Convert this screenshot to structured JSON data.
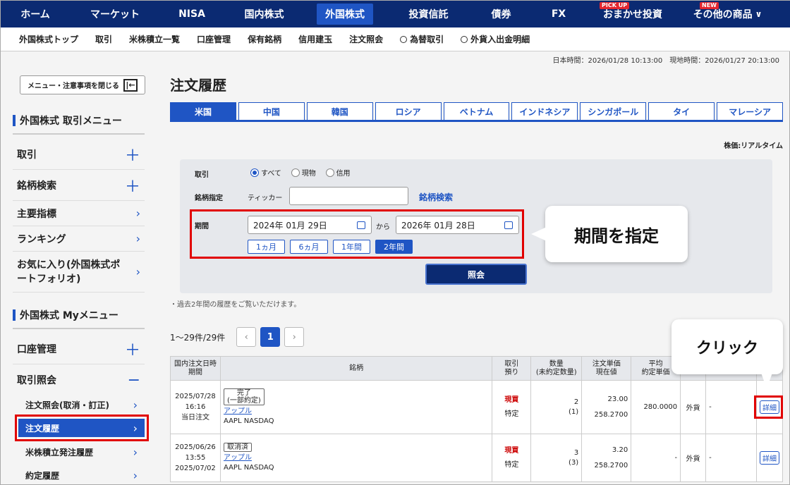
{
  "topnav": {
    "items": [
      "ホーム",
      "マーケット",
      "NISA",
      "国内株式",
      "外国株式",
      "投資信託",
      "債券",
      "FX",
      "おまかせ投資",
      "その他の商品"
    ],
    "badge_pickup": "PICK UP",
    "badge_new": "NEW",
    "chevron": "∨"
  },
  "subnav": {
    "items": [
      "外国株式トップ",
      "取引",
      "米株積立一覧",
      "口座管理",
      "保有銘柄",
      "信用建玉",
      "注文照会",
      "為替取引",
      "外貨入出金明細"
    ]
  },
  "times": {
    "text": "日本時間：2026/01/28 10:13:00　現地時間：2026/01/27 20:13:00"
  },
  "sidebar": {
    "close_label": "メニュー・注意事項を閉じる",
    "section1": "外国株式 取引メニュー",
    "items1": [
      "取引",
      "銘柄検索",
      "主要指標",
      "ランキング",
      "お気に入り(外国株式ポートフォリオ)"
    ],
    "section2": "外国株式 Myメニュー",
    "items2": [
      "口座管理",
      "取引照会"
    ],
    "sub_items": [
      "注文照会(取消・訂正)",
      "注文履歴",
      "米株積立発注履歴",
      "約定履歴"
    ],
    "plus": "＋",
    "minus": "−",
    "chev": "›"
  },
  "main": {
    "title": "注文履歴",
    "tabs": [
      "米国",
      "中国",
      "韓国",
      "ロシア",
      "ベトナム",
      "インドネシア",
      "シンガポール",
      "タイ",
      "マレーシア"
    ],
    "realtime": "株価:リアルタイム"
  },
  "form": {
    "trade_label": "取引",
    "radios": [
      "すべて",
      "現物",
      "信用"
    ],
    "symbol_label": "銘柄指定",
    "ticker_label": "ティッカー",
    "ticker_value": "",
    "search_link": "銘柄検索",
    "period_label": "期間",
    "date_from": "2024年 01月 29日",
    "from_label": "から",
    "date_to": "2026年 01月 28日",
    "period_buttons": [
      "1ヵ月",
      "6ヵ月",
      "1年間",
      "2年間"
    ],
    "submit": "照会"
  },
  "callouts": {
    "period": "期間を指定",
    "click": "クリック"
  },
  "note": "・過去2年間の履歴をご覧いただけます。",
  "pager": {
    "count": "1～29件/29件",
    "prev": "‹",
    "page": "1",
    "next": "›"
  },
  "table": {
    "headers": [
      "国内注文日時\n期間",
      "銘柄",
      "取引\n預り",
      "数量\n(未約定数量)",
      "注文単価\n現在値",
      "平均\n約定単価",
      "",
      ""
    ],
    "rows": [
      {
        "date": "2025/07/28",
        "time": "16:16",
        "period": "当日注文",
        "status": "完了\n(一部約定)",
        "name": "アップル",
        "ticker": "AAPL NASDAQ",
        "trade": "現買",
        "acct": "特定",
        "qty": "2",
        "qty2": "(1)",
        "price": "23.00",
        "current": "258.2700",
        "avg": "280.0000",
        "ccy": "外貨",
        "dash": "-",
        "detail": "詳細"
      },
      {
        "date": "2025/06/26",
        "time": "13:55",
        "period": "2025/07/02",
        "status": "取消済",
        "name": "アップル",
        "ticker": "AAPL NASDAQ",
        "trade": "現買",
        "acct": "特定",
        "qty": "3",
        "qty2": "(3)",
        "price": "3.20",
        "current": "258.2700",
        "avg": "-",
        "ccy": "外貨",
        "dash": "-",
        "detail": "詳細"
      }
    ]
  }
}
